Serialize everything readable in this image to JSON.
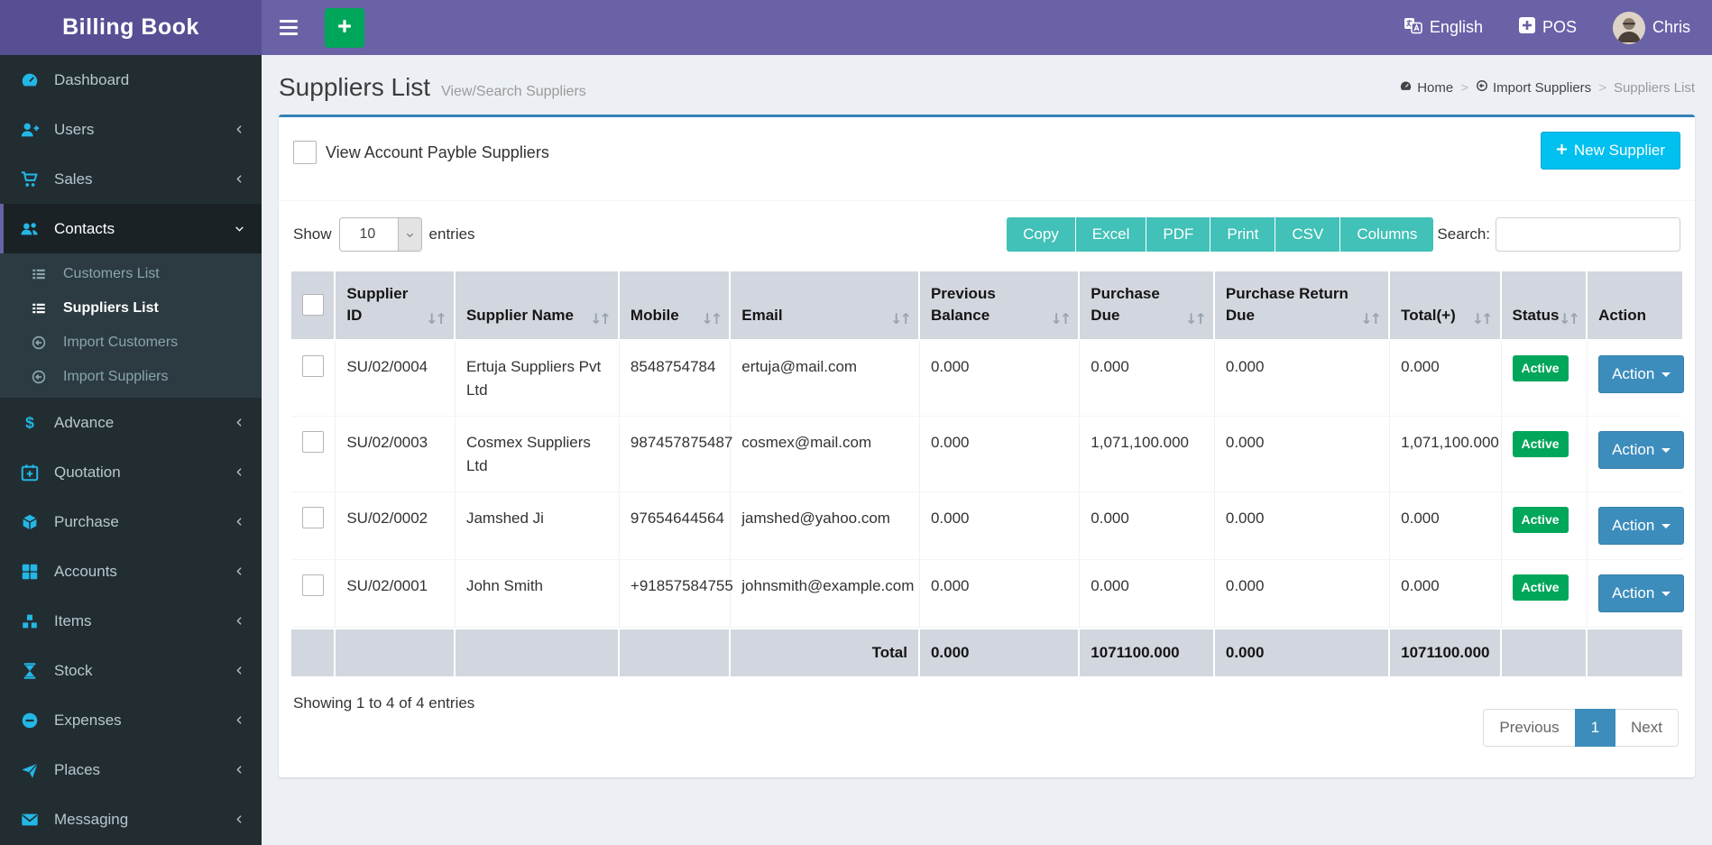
{
  "app": {
    "title": "Billing Book"
  },
  "topbar": {
    "language_label": "English",
    "pos_label": "POS",
    "username": "Chris"
  },
  "page": {
    "title": "Suppliers List",
    "subtitle": "View/Search Suppliers",
    "breadcrumb": [
      {
        "label": "Home"
      },
      {
        "label": "Import Suppliers"
      },
      {
        "label": "Suppliers List"
      }
    ]
  },
  "sidebar": {
    "items": [
      {
        "label": "Dashboard"
      },
      {
        "label": "Users"
      },
      {
        "label": "Sales"
      },
      {
        "label": "Contacts"
      },
      {
        "label": "Advance"
      },
      {
        "label": "Quotation"
      },
      {
        "label": "Purchase"
      },
      {
        "label": "Accounts"
      },
      {
        "label": "Items"
      },
      {
        "label": "Stock"
      },
      {
        "label": "Expenses"
      },
      {
        "label": "Places"
      },
      {
        "label": "Messaging"
      }
    ],
    "contacts_submenu": [
      {
        "label": "Customers List"
      },
      {
        "label": "Suppliers List"
      },
      {
        "label": "Import Customers"
      },
      {
        "label": "Import Suppliers"
      }
    ]
  },
  "box": {
    "checkbox_label": "View Account Payble Suppliers",
    "new_supplier_label": "New Supplier"
  },
  "datatable": {
    "show_label": "Show",
    "page_length": "10",
    "entries_label": "entries",
    "export_buttons": [
      "Copy",
      "Excel",
      "PDF",
      "Print",
      "CSV",
      "Columns"
    ],
    "search_label": "Search:",
    "search_value": "",
    "sort_icon": "↓↑",
    "columns": [
      "Supplier ID",
      "Supplier Name",
      "Mobile",
      "Email",
      "Previous Balance",
      "Purchase Due",
      "Purchase Return Due",
      "Total(+)",
      "Status",
      "Action"
    ],
    "rows": [
      {
        "supplier_id": "SU/02/0004",
        "name": "Ertuja Suppliers Pvt Ltd",
        "mobile": "8548754784",
        "email": "ertuja@mail.com",
        "previous_balance": "0.000",
        "purchase_due": "0.000",
        "purchase_return_due": "0.000",
        "total": "0.000",
        "status": "Active",
        "action_label": "Action"
      },
      {
        "supplier_id": "SU/02/0003",
        "name": "Cosmex Suppliers Ltd",
        "mobile": "987457875487",
        "email": "cosmex@mail.com",
        "previous_balance": "0.000",
        "purchase_due": "1,071,100.000",
        "purchase_return_due": "0.000",
        "total": "1,071,100.000",
        "status": "Active",
        "action_label": "Action"
      },
      {
        "supplier_id": "SU/02/0002",
        "name": "Jamshed Ji",
        "mobile": "97654644564",
        "email": "jamshed@yahoo.com",
        "previous_balance": "0.000",
        "purchase_due": "0.000",
        "purchase_return_due": "0.000",
        "total": "0.000",
        "status": "Active",
        "action_label": "Action"
      },
      {
        "supplier_id": "SU/02/0001",
        "name": "John Smith",
        "mobile": "+91857584755",
        "email": "johnsmith@example.com",
        "previous_balance": "0.000",
        "purchase_due": "0.000",
        "purchase_return_due": "0.000",
        "total": "0.000",
        "status": "Active",
        "action_label": "Action"
      }
    ],
    "footer": {
      "label": "Total",
      "previous_balance": "0.000",
      "purchase_due": "1071100.000",
      "purchase_return_due": "0.000",
      "total": "1071100.000"
    },
    "info": "Showing 1 to 4 of 4 entries",
    "pagination": {
      "previous": "Previous",
      "page": "1",
      "next": "Next"
    }
  },
  "colors": {
    "navbar": "#6a62a7",
    "logo_bg": "#564f94",
    "sidebar_bg": "#222d32",
    "accent_blue": "#3c8dbc",
    "box_top_border": "#3581b8",
    "teal_button": "#41c1b7",
    "cyan_button": "#00c0ef",
    "green": "#00a65a",
    "table_header_bg": "#d2d6de",
    "sidebar_icon": "#23b7e5"
  }
}
